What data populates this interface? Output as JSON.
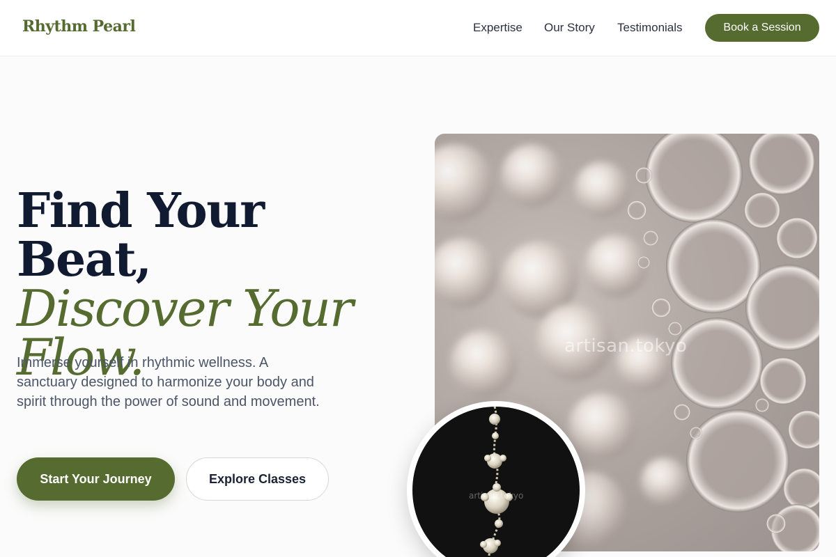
{
  "header": {
    "brand": "Rhythm Pearl",
    "nav": [
      "Expertise",
      "Our Story",
      "Testimonials"
    ],
    "cta": "Book a Session"
  },
  "hero": {
    "title_line1": "Find Your Beat,",
    "title_line2": "Discover Your",
    "title_line3": "Flow.",
    "description": "Immerse yourself in rhythmic wellness. A sanctuary designed to harmonize your body and spirit through the power of sound and movement.",
    "primary_button": "Start Your Journey",
    "secondary_button": "Explore Classes"
  },
  "images": {
    "main_watermark": "artisan.tokyo",
    "inset_watermark": "artisan.tokyo"
  },
  "colors": {
    "accent": "#556b2f",
    "heading": "#101a30",
    "body_text": "#4b5568",
    "background": "#fbfbfb"
  }
}
